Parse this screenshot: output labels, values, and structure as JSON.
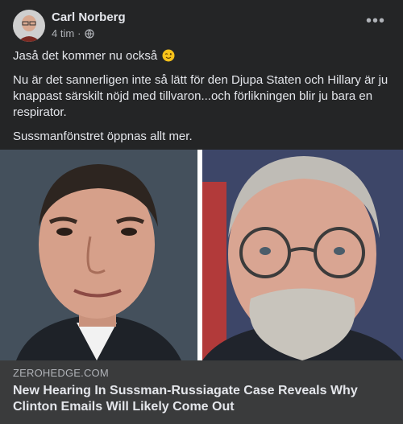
{
  "post": {
    "author": "Carl Norberg",
    "time": "4 tim",
    "separator": "·",
    "more_label": "•••",
    "audience_icon": "globe-icon",
    "paragraphs": [
      "Jaså det kommer nu också",
      "Nu är det sannerligen inte så lätt för den Djupa Staten och Hillary är ju knappast särskilt nöjd med tillvaron...och förlikningen blir ju bara en respirator.",
      "Sussmanfönstret öppnas allt mer."
    ],
    "emoji": "winking-face"
  },
  "link": {
    "domain": "ZEROHEDGE.COM",
    "title": "New Hearing In Sussman-Russiagate Case Reveals Why Clinton Emails Will Likely Come Out"
  },
  "colors": {
    "card_bg": "#242526",
    "text_primary": "#e4e6eb",
    "text_secondary": "#b0b3b8",
    "link_bg": "#3a3b3c"
  }
}
